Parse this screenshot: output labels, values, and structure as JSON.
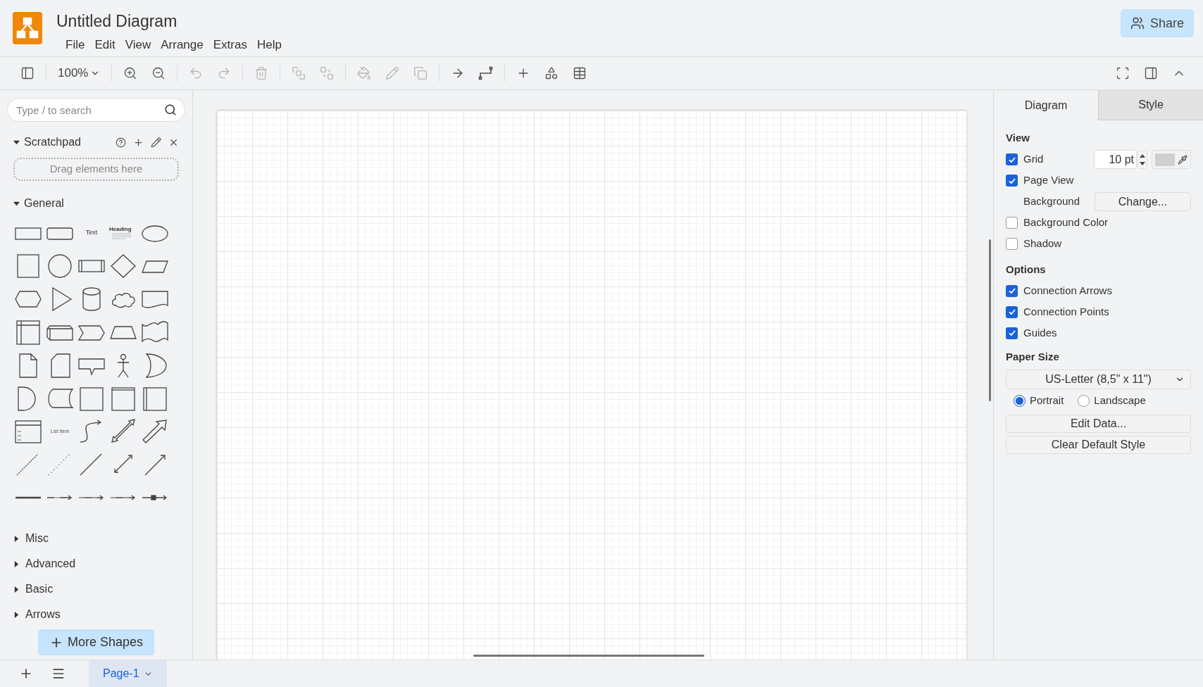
{
  "window": {
    "title": "Untitled Diagram"
  },
  "menu": [
    "File",
    "Edit",
    "View",
    "Arrange",
    "Extras",
    "Help"
  ],
  "share_button": "Share",
  "toolbar": {
    "zoom": "100%",
    "tools": [
      {
        "kind": "format-panel",
        "disabled": false
      },
      {
        "kind": "zoom-in",
        "disabled": false
      },
      {
        "kind": "zoom-out",
        "disabled": false
      },
      {
        "kind": "undo",
        "disabled": true
      },
      {
        "kind": "redo",
        "disabled": true
      },
      {
        "kind": "delete",
        "disabled": true
      },
      {
        "kind": "to-front",
        "disabled": true
      },
      {
        "kind": "to-back",
        "disabled": true
      },
      {
        "kind": "fill-color",
        "disabled": true
      },
      {
        "kind": "line-color",
        "disabled": true
      },
      {
        "kind": "shadow",
        "disabled": true
      },
      {
        "kind": "connection",
        "disabled": false
      },
      {
        "kind": "waypoints",
        "disabled": false
      },
      {
        "kind": "insert",
        "disabled": false
      },
      {
        "kind": "shapes",
        "disabled": false
      },
      {
        "kind": "table",
        "disabled": false
      }
    ],
    "right_tools": [
      {
        "kind": "fullscreen"
      },
      {
        "kind": "format-toggle"
      },
      {
        "kind": "collapse"
      }
    ]
  },
  "sidebar": {
    "search": {
      "placeholder": "Type / to search"
    },
    "scratchpad": {
      "title": "Scratchpad",
      "expanded": true,
      "drop_hint": "Drag elements here"
    },
    "general": {
      "title": "General",
      "expanded": true,
      "shapes": [
        {
          "kind": "rect"
        },
        {
          "kind": "rounded"
        },
        {
          "kind": "text",
          "label": "Text"
        },
        {
          "kind": "heading",
          "label": "Heading"
        },
        {
          "kind": "ellipse"
        },
        {
          "kind": "square"
        },
        {
          "kind": "circle"
        },
        {
          "kind": "process"
        },
        {
          "kind": "diamond"
        },
        {
          "kind": "parallelogram"
        },
        {
          "kind": "hexagon"
        },
        {
          "kind": "triangle"
        },
        {
          "kind": "cylinder"
        },
        {
          "kind": "cloud"
        },
        {
          "kind": "document"
        },
        {
          "kind": "storage"
        },
        {
          "kind": "cube"
        },
        {
          "kind": "step"
        },
        {
          "kind": "trapezoid"
        },
        {
          "kind": "tape"
        },
        {
          "kind": "note"
        },
        {
          "kind": "card"
        },
        {
          "kind": "callout"
        },
        {
          "kind": "actor"
        },
        {
          "kind": "crescent"
        },
        {
          "kind": "and"
        },
        {
          "kind": "datastore"
        },
        {
          "kind": "container"
        },
        {
          "kind": "titled-container"
        },
        {
          "kind": "side-container"
        },
        {
          "kind": "list"
        },
        {
          "kind": "list-item",
          "label": "List Item"
        },
        {
          "kind": "curve"
        },
        {
          "kind": "double-arrow"
        },
        {
          "kind": "block-arrow"
        },
        {
          "kind": "dashed"
        },
        {
          "kind": "dotted"
        },
        {
          "kind": "line"
        },
        {
          "kind": "bidi"
        },
        {
          "kind": "directed"
        },
        {
          "kind": "thick"
        },
        {
          "kind": "labeled"
        },
        {
          "kind": "labeled2"
        },
        {
          "kind": "labeled3"
        },
        {
          "kind": "symbol"
        }
      ]
    },
    "sections": [
      {
        "title": "Misc",
        "expanded": false
      },
      {
        "title": "Advanced",
        "expanded": false
      },
      {
        "title": "Basic",
        "expanded": false
      },
      {
        "title": "Arrows",
        "expanded": false
      }
    ],
    "more_shapes": "More Shapes"
  },
  "format_panel": {
    "tabs": [
      {
        "label": "Diagram",
        "selected": true
      },
      {
        "label": "Style",
        "selected": false
      }
    ],
    "view": {
      "title": "View",
      "grid": {
        "label": "Grid",
        "checked": true,
        "size": "10 pt"
      },
      "page_view": {
        "label": "Page View",
        "checked": true
      },
      "background": {
        "label": "Background",
        "button": "Change..."
      },
      "background_color": {
        "label": "Background Color",
        "checked": false
      },
      "shadow": {
        "label": "Shadow",
        "checked": false
      }
    },
    "options": {
      "title": "Options",
      "items": [
        {
          "label": "Connection Arrows",
          "checked": true
        },
        {
          "label": "Connection Points",
          "checked": true
        },
        {
          "label": "Guides",
          "checked": true
        }
      ]
    },
    "paper_size": {
      "title": "Paper Size",
      "value": "US-Letter (8,5\" x 11\")",
      "orientation": [
        {
          "label": "Portrait",
          "selected": true
        },
        {
          "label": "Landscape",
          "selected": false
        }
      ]
    },
    "buttons": [
      "Edit Data...",
      "Clear Default Style"
    ]
  },
  "bottom_bar": {
    "pages": [
      {
        "label": "Page-1",
        "selected": true
      }
    ]
  }
}
